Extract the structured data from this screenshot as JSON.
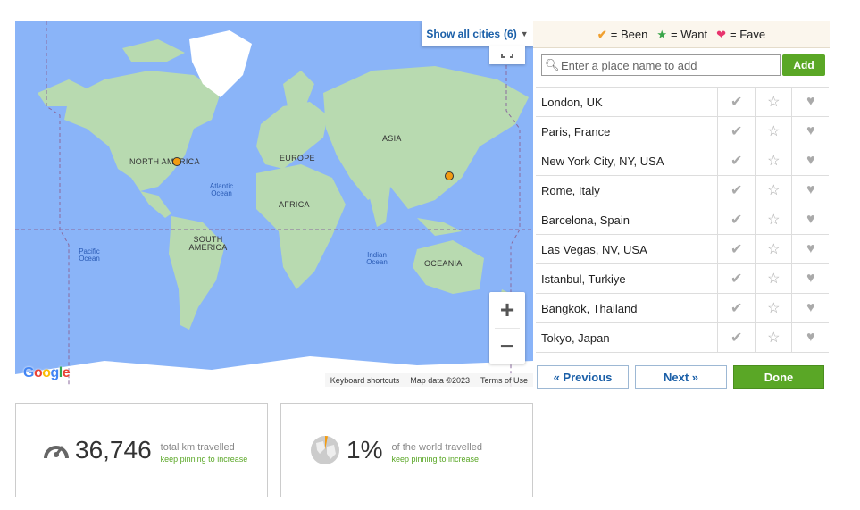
{
  "map": {
    "show_all_label": "Show all cities",
    "city_count": "(6)",
    "labels": {
      "north_america": "NORTH AMERICA",
      "europe": "EUROPE",
      "asia": "ASIA",
      "africa": "AFRICA",
      "south_america": "SOUTH AMERICA",
      "oceania": "OCEANIA",
      "atlantic": "Atlantic Ocean",
      "pacific": "Pacific Ocean",
      "indian": "Indian Ocean"
    },
    "zoom_in": "+",
    "zoom_out": "−",
    "logo": "Google",
    "attribution": {
      "shortcuts": "Keyboard shortcuts",
      "map_data": "Map data ©2023",
      "terms": "Terms of Use"
    },
    "colors": {
      "water": "#8ab4f8",
      "land": "#b8dab0",
      "pin": "#f39c12"
    }
  },
  "legend": {
    "been_icon": "✔",
    "been_label": "= Been",
    "want_icon": "★",
    "want_label": "= Want",
    "fave_icon": "❤",
    "fave_label": "= Fave"
  },
  "search": {
    "placeholder": "Enter a place name to add",
    "add_label": "Add"
  },
  "cities": [
    {
      "name": "London, UK"
    },
    {
      "name": "Paris, France"
    },
    {
      "name": "New York City, NY, USA"
    },
    {
      "name": "Rome, Italy"
    },
    {
      "name": "Barcelona, Spain"
    },
    {
      "name": "Las Vegas, NV, USA"
    },
    {
      "name": "Istanbul, Turkiye"
    },
    {
      "name": "Bangkok, Thailand"
    },
    {
      "name": "Tokyo, Japan"
    }
  ],
  "row_icons": {
    "been": "✔",
    "want": "☆",
    "fave": "♥"
  },
  "pager": {
    "prev": "« Previous",
    "next": "Next »",
    "done": "Done"
  },
  "stats": {
    "distance": {
      "value": "36,746",
      "label": "total km travelled",
      "hint": "keep pinning to increase"
    },
    "world": {
      "value": "1%",
      "label": "of the world travelled",
      "hint": "keep pinning to increase"
    }
  }
}
